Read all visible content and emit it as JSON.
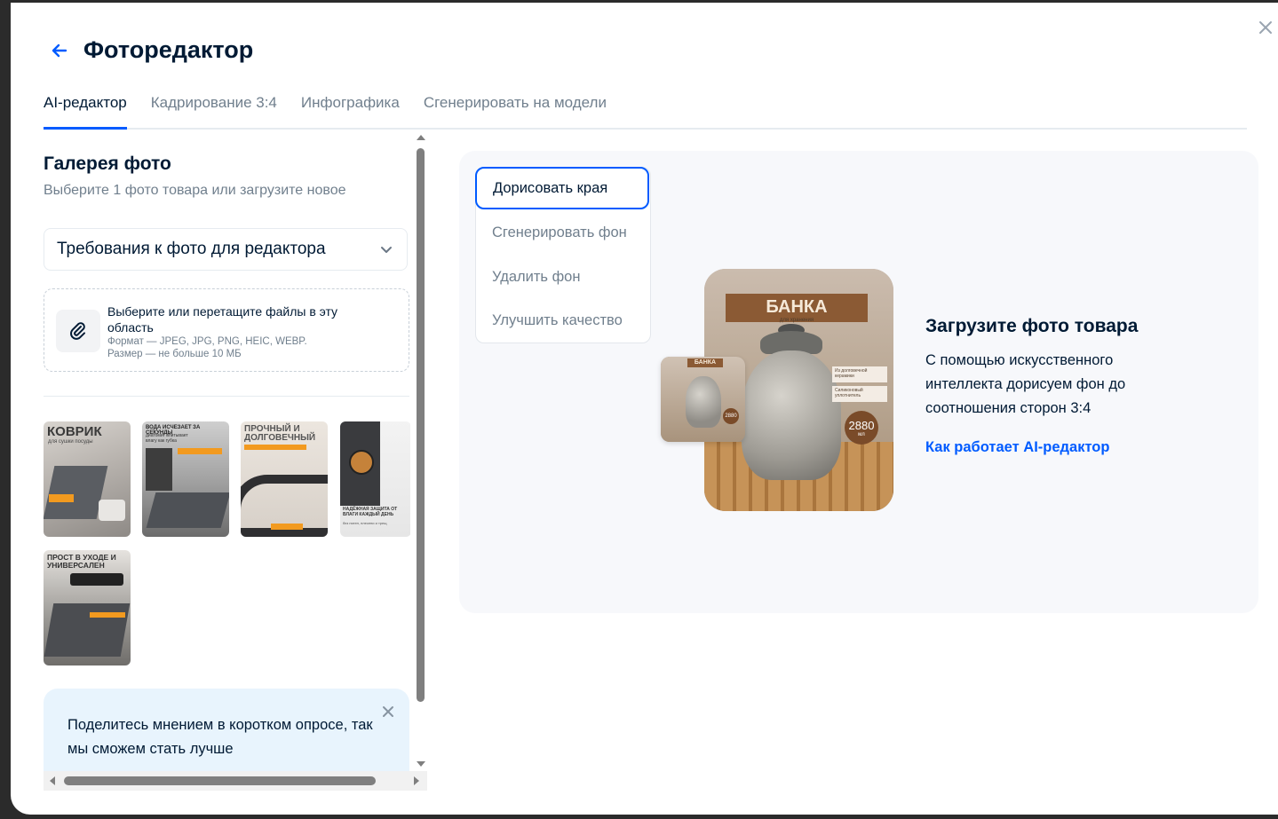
{
  "modal": {
    "title": "Фоторедактор",
    "tabs": [
      "AI-редактор",
      "Кадрирование 3:4",
      "Инфографика",
      "Сгенерировать на модели"
    ],
    "active_tab": "AI-редактор"
  },
  "gallery": {
    "title": "Галерея фото",
    "subtitle": "Выберите 1 фото товара или загрузите новое",
    "requirements_label": "Требования к фото для редактора",
    "upload": {
      "main": "Выберите или перетащите файлы в эту область",
      "format": "Формат — JPEG, JPG, PNG, HEIC, WEBP.",
      "size": "Размер — не больше 10 МБ"
    },
    "thumbnails": [
      {
        "caption": "КОВРИК",
        "subcaption": "для сушки посуды"
      },
      {
        "caption": "ВОДА ИСЧЕЗАЕТ ЗА СЕКУНДЫ",
        "subcaption": "диатомит впитывает влагу как губка"
      },
      {
        "caption": "ПРОЧНЫЙ И ДОЛГОВЕЧНЫЙ",
        "subcaption": ""
      },
      {
        "caption": "НАДЁЖНАЯ ЗАЩИТА ОТ ВЛАГИ КАЖДЫЙ ДЕНЬ",
        "subcaption": "без пятен, плесени и трещ"
      },
      {
        "caption": "ПРОСТ В УХОДЕ И УНИВЕРСАЛЕН",
        "subcaption": ""
      }
    ]
  },
  "survey": {
    "text": "Поделитесь мнением в коротком опросе, так мы сможем стать лучше"
  },
  "editor": {
    "modes": [
      "Дорисовать края",
      "Сгенерировать фон",
      "Удалить фон",
      "Улучшить качество"
    ],
    "active_mode": "Дорисовать края",
    "preview": {
      "product_title": "БАНКА",
      "product_sub": "для хранения",
      "badge_value": "2880",
      "badge_unit": "мл",
      "feature_1": "Из долговечной керамики",
      "feature_2": "Силиконовый уплотнитель"
    },
    "info_title": "Загрузите фото товара",
    "info_text": "С помощью искусственного интеллекта дорисуем фон до соотношения сторон 3:4",
    "info_link": "Как работает AI-редактор"
  },
  "colors": {
    "accent": "#005bff",
    "text": "#001a34",
    "muted": "#707f8d",
    "survey_bg": "#e8f4fd"
  },
  "icons": [
    "back-arrow-icon",
    "close-icon",
    "chevron-down-icon",
    "paperclip-icon",
    "scroll-up-icon",
    "scroll-down-icon",
    "scroll-left-icon",
    "scroll-right-icon"
  ]
}
